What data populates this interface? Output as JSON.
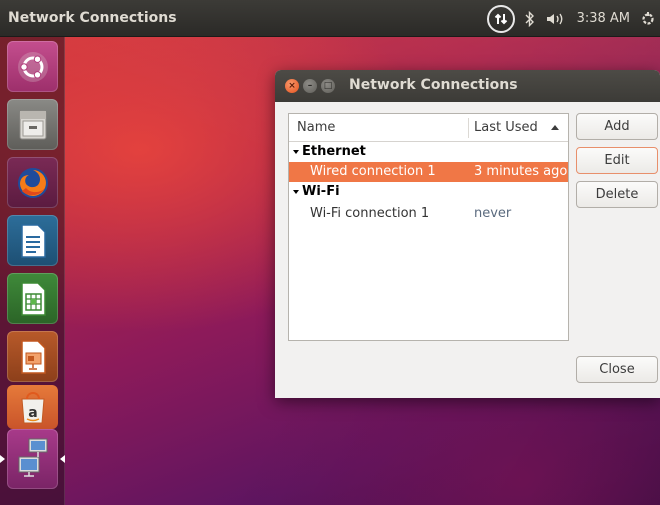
{
  "top_panel": {
    "title": "Network Connections",
    "clock": "3:38 AM",
    "indicators": [
      "network-icon",
      "bluetooth-icon",
      "volume-icon",
      "power-gear-icon"
    ]
  },
  "launcher": {
    "apps": [
      "ubuntu-dash",
      "files",
      "firefox",
      "libreoffice-writer",
      "libreoffice-calc",
      "libreoffice-impress",
      "ubuntu-software",
      "network-connections"
    ]
  },
  "dialog": {
    "title": "Network Connections",
    "columns": {
      "name": "Name",
      "last_used": "Last Used"
    },
    "groups": [
      {
        "label": "Ethernet",
        "connections": [
          {
            "name": "Wired connection 1",
            "last_used": "3 minutes ago",
            "selected": true
          }
        ]
      },
      {
        "label": "Wi-Fi",
        "connections": [
          {
            "name": "Wi-Fi connection 1",
            "last_used": "never",
            "selected": false
          }
        ]
      }
    ],
    "buttons": {
      "add": "Add",
      "edit": "Edit",
      "delete": "Delete",
      "close": "Close"
    }
  },
  "colors": {
    "selection": "#f07746",
    "panel": "#3c3b37",
    "close_button": "#e5511d"
  }
}
